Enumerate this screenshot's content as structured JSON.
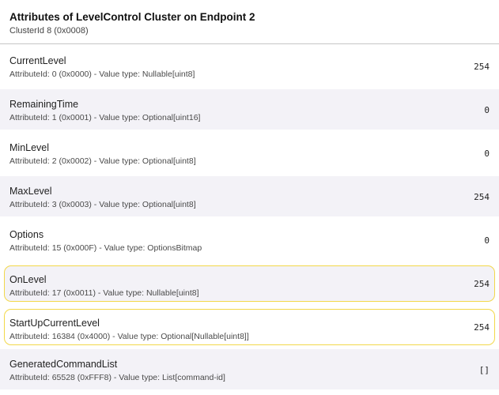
{
  "header": {
    "title": "Attributes of LevelControl Cluster on Endpoint 2",
    "subtitle": "ClusterId 8 (0x0008)"
  },
  "attributes": [
    {
      "name": "CurrentLevel",
      "description": "AttributeId: 0 (0x0000) - Value type: Nullable[uint8]",
      "value": "254"
    },
    {
      "name": "RemainingTime",
      "description": "AttributeId: 1 (0x0001) - Value type: Optional[uint16]",
      "value": "0"
    },
    {
      "name": "MinLevel",
      "description": "AttributeId: 2 (0x0002) - Value type: Optional[uint8]",
      "value": "0"
    },
    {
      "name": "MaxLevel",
      "description": "AttributeId: 3 (0x0003) - Value type: Optional[uint8]",
      "value": "254"
    },
    {
      "name": "Options",
      "description": "AttributeId: 15 (0x000F) - Value type: OptionsBitmap",
      "value": "0"
    },
    {
      "name": "OnLevel",
      "description": "AttributeId: 17 (0x0011) - Value type: Nullable[uint8]",
      "value": "254"
    },
    {
      "name": "StartUpCurrentLevel",
      "description": "AttributeId: 16384 (0x4000) - Value type: Optional[Nullable[uint8]]",
      "value": "254"
    },
    {
      "name": "GeneratedCommandList",
      "description": "AttributeId: 65528 (0xFFF8) - Value type: List[command-id]",
      "value": "[]"
    }
  ],
  "colors": {
    "row_alt_background": "#f3f2f7",
    "highlight_border": "#f2d84a"
  }
}
